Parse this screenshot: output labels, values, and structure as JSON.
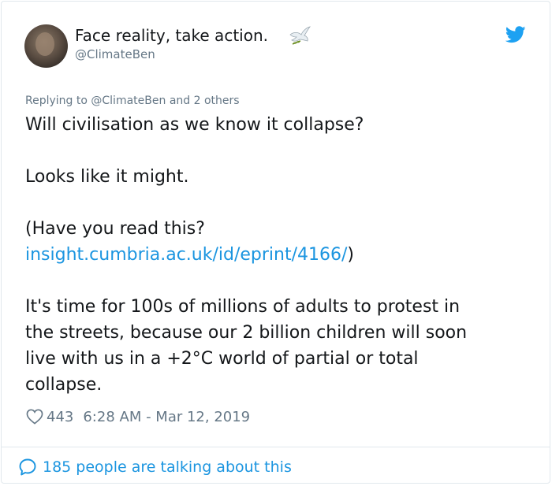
{
  "author": {
    "display_name": "Face reality, take action.",
    "handle": "@ClimateBen"
  },
  "reply_context": {
    "prefix": "Replying to",
    "mention": "@ClimateBen",
    "suffix": "and 2 others"
  },
  "tweet": {
    "line1": "Will civilisation as we know it collapse?",
    "line2": "Looks like it might.",
    "line3": "(Have you read this?",
    "link_text": "insight.cumbria.ac.uk/id/eprint/4166/",
    "link_suffix": ")",
    "para_lines": [
      "It's time for 100s of millions of adults to protest in",
      "the streets, because our 2 billion children will soon",
      "live with us in a +2°C world of partial or total",
      "collapse."
    ]
  },
  "stats": {
    "likes": "443",
    "timestamp": "6:28 AM - Mar 12, 2019"
  },
  "footer": {
    "talking_text": "185 people are talking about this"
  },
  "colors": {
    "link": "#1b95e0",
    "muted": "#657786",
    "text": "#14171a",
    "border": "#e1e8ed"
  },
  "icons": [
    "dove-emoji-icon",
    "twitter-bird-icon",
    "heart-icon",
    "speech-bubble-icon"
  ]
}
